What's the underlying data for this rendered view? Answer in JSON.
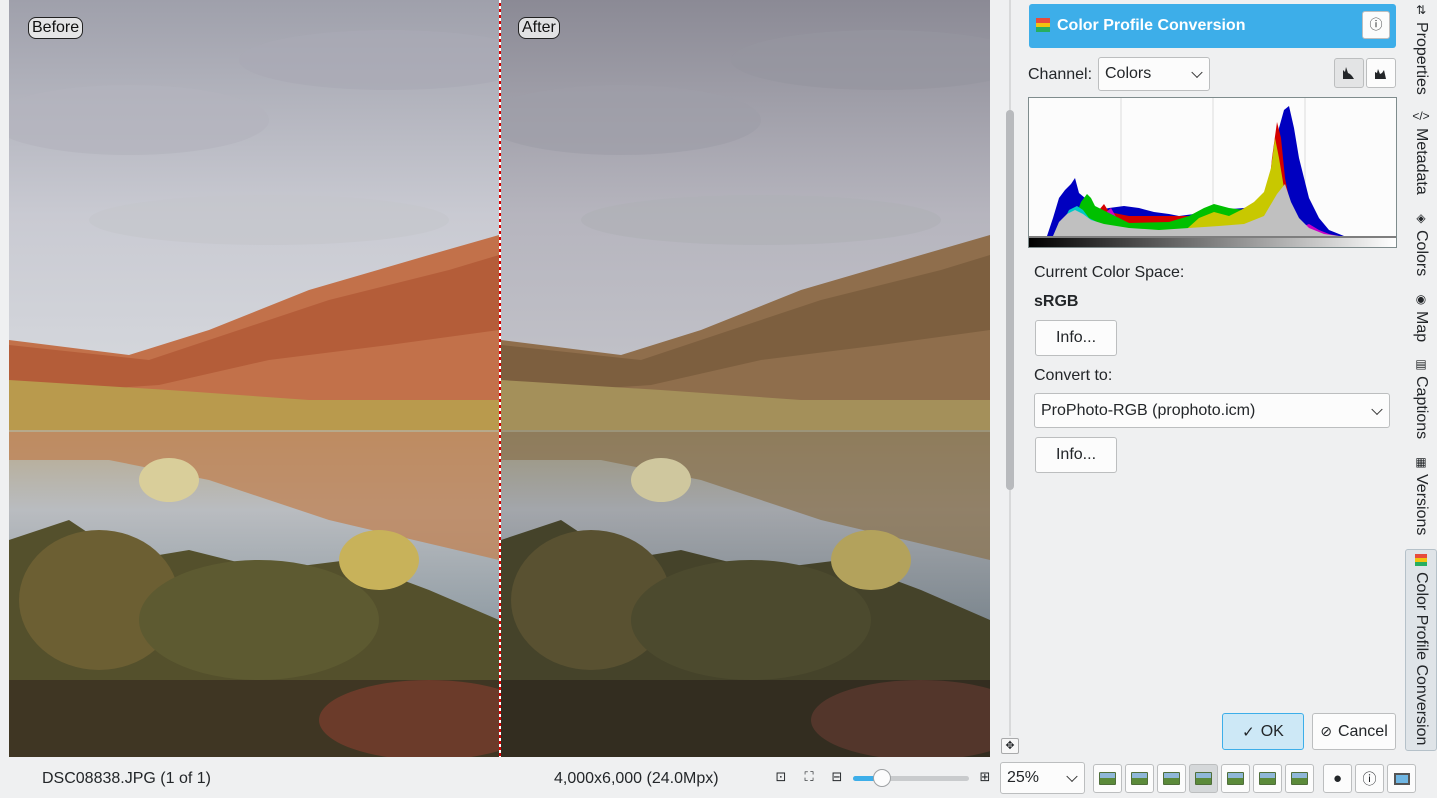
{
  "preview": {
    "before_label": "Before",
    "after_label": "After"
  },
  "tool": {
    "title": "Color Profile Conversion",
    "info_icon": "info-icon",
    "channel_label": "Channel:",
    "channel_value": "Colors",
    "current_color_space_label": "Current Color Space:",
    "current_color_space_value": "sRGB",
    "info_button_label": "Info...",
    "convert_to_label": "Convert to:",
    "convert_to_value": "ProPhoto-RGB (prophoto.icm)",
    "info_button2_label": "Info...",
    "ok_label": "OK",
    "cancel_label": "Cancel"
  },
  "sidebar_tabs": [
    {
      "label": "Properties",
      "icon": "properties-icon"
    },
    {
      "label": "Metadata",
      "icon": "metadata-icon"
    },
    {
      "label": "Colors",
      "icon": "colors-icon"
    },
    {
      "label": "Map",
      "icon": "map-icon"
    },
    {
      "label": "Captions",
      "icon": "captions-icon"
    },
    {
      "label": "Versions",
      "icon": "versions-icon"
    },
    {
      "label": "Color Profile Conversion",
      "icon": "color-profile-icon",
      "active": true
    }
  ],
  "status": {
    "filename": "DSC08838.JPG (1 of 1)",
    "dimensions": "4,000x6,000 (24.0Mpx)",
    "zoom_value": "25%",
    "zoom_fraction": 0.2
  },
  "colors": {
    "accent": "#3daee9",
    "histogram_red": "#d40000",
    "histogram_green": "#00c000",
    "histogram_blue": "#0000c0",
    "histogram_yellow": "#c8c800",
    "histogram_cyan": "#00c8c8",
    "histogram_magenta": "#c800c8",
    "histogram_gray": "#c0c0c0"
  }
}
